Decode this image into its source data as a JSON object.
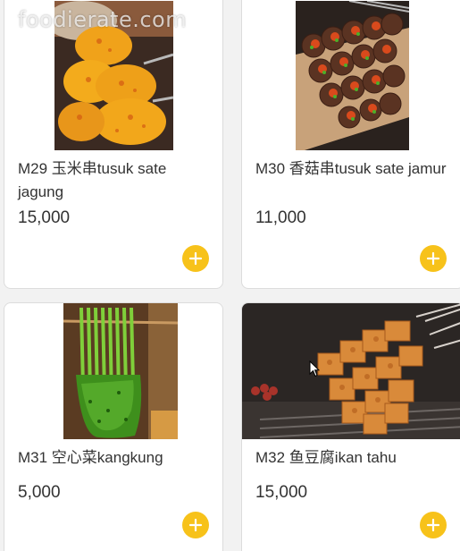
{
  "watermark": "foodierate.com",
  "colors": {
    "accent": "#f7c21a",
    "card_bg": "#ffffff",
    "page_bg": "#f2f2f2",
    "text": "#333333"
  },
  "menu_items": [
    {
      "name": "M29 玉米串tusuk sate jagung",
      "price": "15,000",
      "image": "grilled-corn-photo",
      "add_icon": "plus-icon"
    },
    {
      "name": "M30 香菇串tusuk sate jamur",
      "price": "11,000",
      "image": "grilled-mushroom-photo",
      "add_icon": "plus-icon"
    },
    {
      "name": "M31 空心菜kangkung",
      "price": "5,000",
      "image": "kangkung-skewer-photo",
      "add_icon": "plus-icon"
    },
    {
      "name": "M32 鱼豆腐ikan tahu",
      "price": "15,000",
      "image": "fish-tofu-skewer-photo",
      "add_icon": "plus-icon"
    }
  ]
}
